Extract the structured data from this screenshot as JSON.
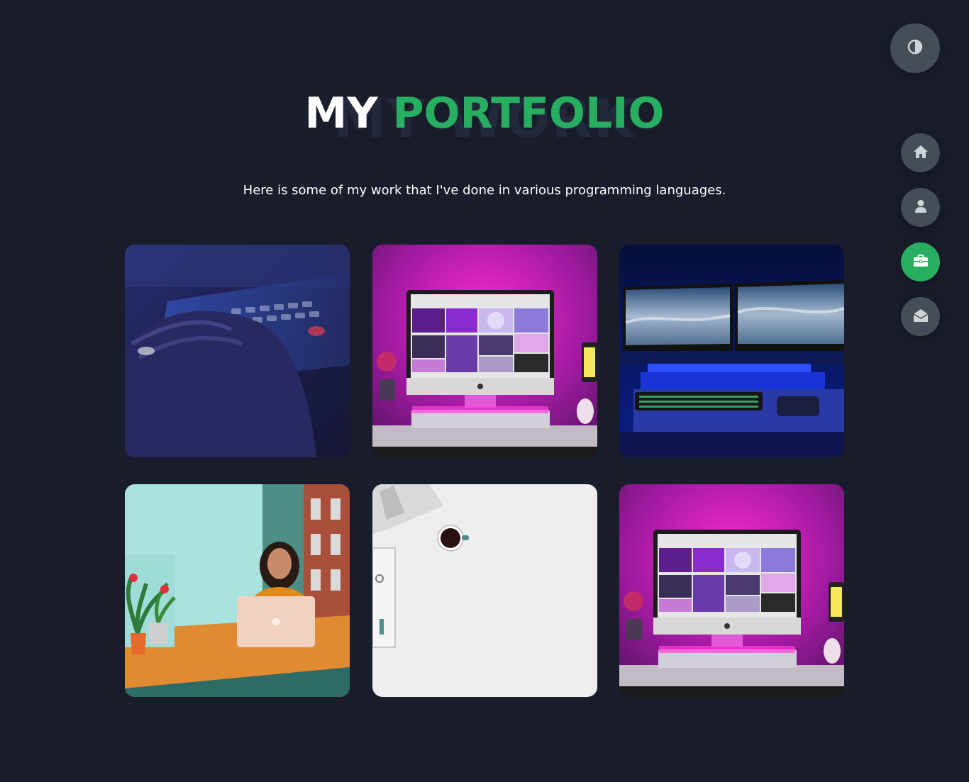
{
  "header": {
    "bg_text": "MY WORK",
    "title_white": "MY",
    "title_accent": "PORTFOLIO",
    "subtitle": "Here is some of my work that I've done in various programming languages."
  },
  "controls": {
    "theme_icon": "contrast-icon"
  },
  "nav": {
    "items": [
      {
        "icon": "home-icon",
        "active": false
      },
      {
        "icon": "user-icon",
        "active": false
      },
      {
        "icon": "briefcase-icon",
        "active": true
      },
      {
        "icon": "envelope-open-icon",
        "active": false
      }
    ]
  },
  "portfolio": {
    "items": [
      {
        "image": "hand-on-keyboard-photo"
      },
      {
        "image": "pink-desk-imac-photo"
      },
      {
        "image": "dual-monitor-blue-desk-photo"
      },
      {
        "image": "woman-with-laptop-photo"
      },
      {
        "image": "white-desk-coffee-photo"
      },
      {
        "image": "pink-desk-imac-photo"
      }
    ]
  },
  "colors": {
    "background": "#191d2b",
    "accent": "#27ae60",
    "button_grey": "#454e56"
  }
}
